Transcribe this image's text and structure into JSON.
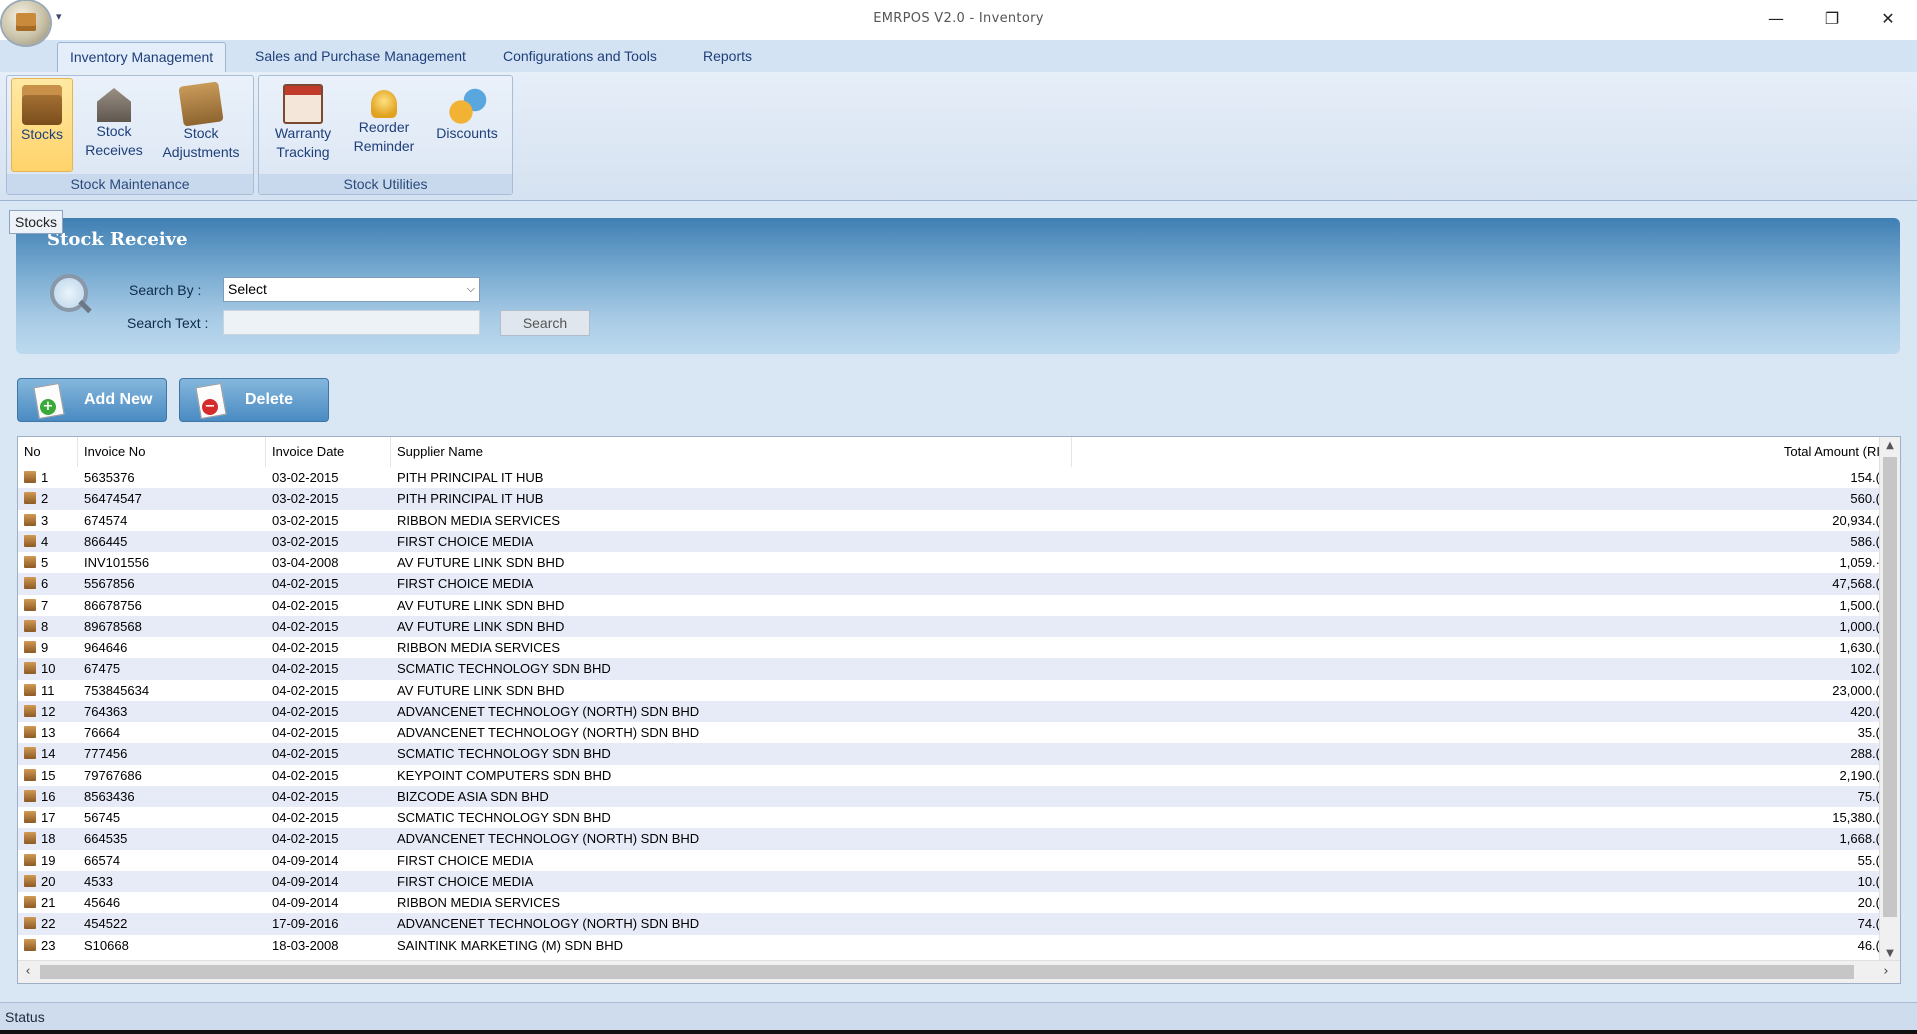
{
  "window": {
    "title": "EMRPOS V2.0 - Inventory",
    "minimize_glyph": "—",
    "maximize_glyph": "❐",
    "close_glyph": "✕",
    "qat_glyph": "▾"
  },
  "ribbon_tabs": [
    {
      "label": "Inventory Management",
      "active": true
    },
    {
      "label": "Sales and Purchase Management",
      "active": false
    },
    {
      "label": "Configurations and Tools",
      "active": false
    },
    {
      "label": "Reports",
      "active": false
    }
  ],
  "ribbon_groups": [
    {
      "label": "Stock Maintenance",
      "buttons": [
        {
          "line1": "Stocks",
          "line2": "",
          "icon": "box-icon",
          "selected": true
        },
        {
          "line1": "Stock",
          "line2": "Receives",
          "icon": "warehouse-icon",
          "selected": false
        },
        {
          "line1": "Stock",
          "line2": "Adjustments",
          "icon": "box-edit-icon",
          "selected": false
        }
      ]
    },
    {
      "label": "Stock Utilities",
      "buttons": [
        {
          "line1": "Warranty",
          "line2": "Tracking",
          "icon": "calendar-icon",
          "selected": false
        },
        {
          "line1": "Reorder",
          "line2": "Reminder",
          "icon": "bell-icon",
          "selected": false
        },
        {
          "line1": "Discounts",
          "line2": "",
          "icon": "coins-icon",
          "selected": false
        }
      ]
    }
  ],
  "doc_tab": "Stocks",
  "panel": {
    "title": "Stock Receive",
    "search_by_label": "Search By :",
    "search_by_value": "Select",
    "search_text_label": "Search Text :",
    "search_text_value": "",
    "search_button": "Search"
  },
  "actions": {
    "add_new": "Add New",
    "delete": "Delete"
  },
  "grid": {
    "columns": [
      "No",
      "Invoice No",
      "Invoice Date",
      "Supplier Name",
      "",
      "Total Amount (RI"
    ],
    "rows": [
      {
        "no": "1",
        "invoice": "5635376",
        "date": "03-02-2015",
        "supplier": "PITH PRINCIPAL IT HUB",
        "amount": "154.("
      },
      {
        "no": "2",
        "invoice": "56474547",
        "date": "03-02-2015",
        "supplier": "PITH PRINCIPAL IT HUB",
        "amount": "560.("
      },
      {
        "no": "3",
        "invoice": "674574",
        "date": "03-02-2015",
        "supplier": "RIBBON MEDIA SERVICES",
        "amount": "20,934.("
      },
      {
        "no": "4",
        "invoice": "866445",
        "date": "03-02-2015",
        "supplier": "FIRST CHOICE MEDIA",
        "amount": "586.("
      },
      {
        "no": "5",
        "invoice": "INV101556",
        "date": "03-04-2008",
        "supplier": "AV FUTURE LINK SDN BHD",
        "amount": "1,059.·"
      },
      {
        "no": "6",
        "invoice": "5567856",
        "date": "04-02-2015",
        "supplier": "FIRST CHOICE MEDIA",
        "amount": "47,568.("
      },
      {
        "no": "7",
        "invoice": "86678756",
        "date": "04-02-2015",
        "supplier": "AV FUTURE LINK SDN BHD",
        "amount": "1,500.("
      },
      {
        "no": "8",
        "invoice": "89678568",
        "date": "04-02-2015",
        "supplier": "AV FUTURE LINK SDN BHD",
        "amount": "1,000.("
      },
      {
        "no": "9",
        "invoice": "964646",
        "date": "04-02-2015",
        "supplier": "RIBBON MEDIA SERVICES",
        "amount": "1,630.("
      },
      {
        "no": "10",
        "invoice": "67475",
        "date": "04-02-2015",
        "supplier": "SCMATIC TECHNOLOGY SDN BHD",
        "amount": "102.("
      },
      {
        "no": "11",
        "invoice": "753845634",
        "date": "04-02-2015",
        "supplier": "AV FUTURE LINK SDN BHD",
        "amount": "23,000.("
      },
      {
        "no": "12",
        "invoice": "764363",
        "date": "04-02-2015",
        "supplier": "ADVANCENET TECHNOLOGY (NORTH) SDN BHD",
        "amount": "420.("
      },
      {
        "no": "13",
        "invoice": "76664",
        "date": "04-02-2015",
        "supplier": "ADVANCENET TECHNOLOGY (NORTH) SDN BHD",
        "amount": "35.("
      },
      {
        "no": "14",
        "invoice": "777456",
        "date": "04-02-2015",
        "supplier": "SCMATIC TECHNOLOGY SDN BHD",
        "amount": "288.("
      },
      {
        "no": "15",
        "invoice": "79767686",
        "date": "04-02-2015",
        "supplier": "KEYPOINT COMPUTERS SDN BHD",
        "amount": "2,190.("
      },
      {
        "no": "16",
        "invoice": "8563436",
        "date": "04-02-2015",
        "supplier": "BIZCODE ASIA SDN BHD",
        "amount": "75.("
      },
      {
        "no": "17",
        "invoice": "56745",
        "date": "04-02-2015",
        "supplier": "SCMATIC TECHNOLOGY SDN BHD",
        "amount": "15,380.("
      },
      {
        "no": "18",
        "invoice": "664535",
        "date": "04-02-2015",
        "supplier": "ADVANCENET TECHNOLOGY (NORTH) SDN BHD",
        "amount": "1,668.("
      },
      {
        "no": "19",
        "invoice": "66574",
        "date": "04-09-2014",
        "supplier": "FIRST CHOICE MEDIA",
        "amount": "55.("
      },
      {
        "no": "20",
        "invoice": "4533",
        "date": "04-09-2014",
        "supplier": "FIRST CHOICE MEDIA",
        "amount": "10.("
      },
      {
        "no": "21",
        "invoice": "45646",
        "date": "04-09-2014",
        "supplier": "RIBBON MEDIA SERVICES",
        "amount": "20.("
      },
      {
        "no": "22",
        "invoice": "454522",
        "date": "17-09-2016",
        "supplier": "ADVANCENET TECHNOLOGY (NORTH) SDN BHD",
        "amount": "74.("
      },
      {
        "no": "23",
        "invoice": "S10668",
        "date": "18-03-2008",
        "supplier": "SAINTINK MARKETING (M) SDN BHD",
        "amount": "46.("
      }
    ]
  },
  "status": "Status"
}
